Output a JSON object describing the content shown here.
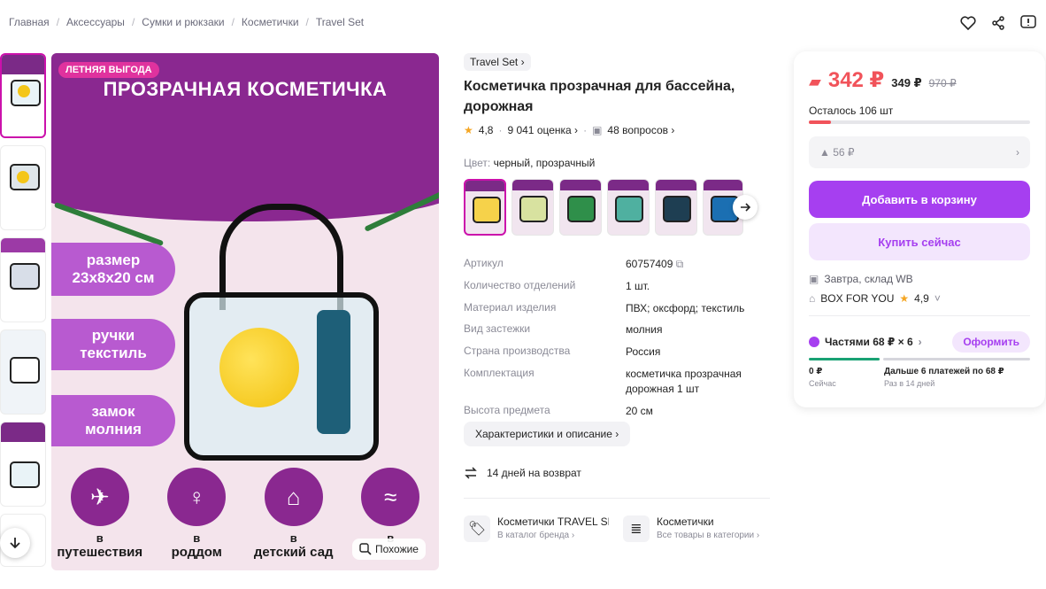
{
  "breadcrumb": [
    "Главная",
    "Аксессуары",
    "Сумки и рюкзаки",
    "Косметички",
    "Travel Set"
  ],
  "image": {
    "badge": "ЛЕТНЯЯ ВЫГОДА",
    "title": "ПРОЗРАЧНАЯ КОСМЕТИЧКА",
    "pills": [
      {
        "l1": "размер",
        "l2": "23х8х20 см"
      },
      {
        "l1": "ручки",
        "l2": "текстиль"
      },
      {
        "l1": "замок",
        "l2": "молния"
      }
    ],
    "circles": [
      {
        "l1": "в",
        "l2": "путешествия"
      },
      {
        "l1": "в",
        "l2": "роддом"
      },
      {
        "l1": "в",
        "l2": "детский сад"
      },
      {
        "l1": "в",
        "l2": "б..."
      }
    ],
    "similar": "Похожие"
  },
  "product": {
    "brand": "Travel Set",
    "title": "Косметичка прозрачная для бассейна, дорожная",
    "rating": "4,8",
    "reviews": "9 041 оценка",
    "questions": "48 вопросов",
    "color_label": "Цвет:",
    "color_value": "черный, прозрачный"
  },
  "specs": [
    {
      "k": "Артикул",
      "v": "60757409"
    },
    {
      "k": "Количество отделений",
      "v": "1 шт."
    },
    {
      "k": "Материал изделия",
      "v": "ПВХ; оксфорд; текстиль"
    },
    {
      "k": "Вид застежки",
      "v": "молния"
    },
    {
      "k": "Страна производства",
      "v": "Россия"
    },
    {
      "k": "Комплектация",
      "v": "косметичка прозрачная дорожная 1 шт"
    },
    {
      "k": "Высота предмета",
      "v": "20 см"
    }
  ],
  "chars_button": "Характеристики и описание",
  "return_text": "14 дней на возврат",
  "links": [
    {
      "t1": "Косметички TRAVEL SET",
      "t2": "В каталог бренда"
    },
    {
      "t1": "Косметички",
      "t2": "Все товары в категории"
    }
  ],
  "buy": {
    "price": "342 ₽",
    "price2": "349 ₽",
    "price_old": "970 ₽",
    "stock": "Осталось 106 шт",
    "stock_level": 0.1,
    "coupon": "▲ 56 ₽",
    "add_to_cart": "Добавить в корзину",
    "buy_now": "Купить сейчас",
    "delivery": "Завтра, склад WB",
    "seller": "BOX FOR YOU",
    "seller_rating": "4,9",
    "parts_label": "Частями 68 ₽ × 6",
    "parts_button": "Оформить",
    "now_amount": "0 ₽",
    "now_label": "Сейчас",
    "later_amount": "Дальше 6 платежей по 68 ₽",
    "later_label": "Раз в 14 дней"
  },
  "colors": {
    "accent": "#a63ff0",
    "price": "#f1535a",
    "brand_purple": "#8a2890"
  }
}
